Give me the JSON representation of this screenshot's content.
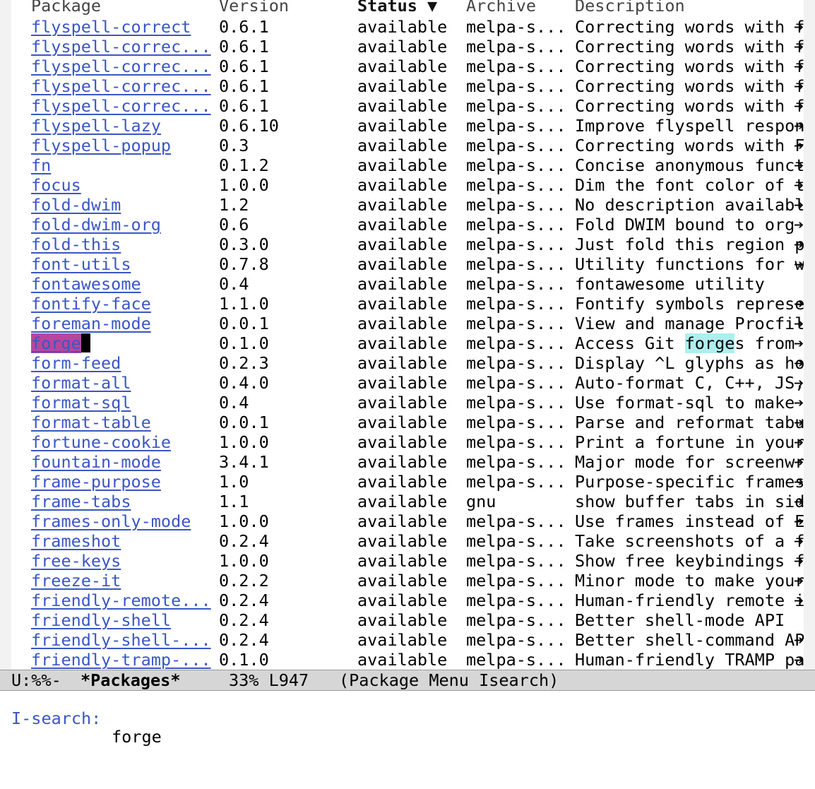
{
  "header": {
    "package": "Package",
    "version": "Version",
    "status": "Status ▼",
    "archive": "Archive",
    "description": "Description"
  },
  "packages": [
    {
      "name": "flyspell-correct",
      "version": "0.6.1",
      "status": "available",
      "archive": "melpa-s...",
      "description": "Correcting words with f",
      "truncated": true
    },
    {
      "name": "flyspell-correc...",
      "version": "0.6.1",
      "status": "available",
      "archive": "melpa-s...",
      "description": "Correcting words with f",
      "truncated": true
    },
    {
      "name": "flyspell-correc...",
      "version": "0.6.1",
      "status": "available",
      "archive": "melpa-s...",
      "description": "Correcting words with f",
      "truncated": true
    },
    {
      "name": "flyspell-correc...",
      "version": "0.6.1",
      "status": "available",
      "archive": "melpa-s...",
      "description": "Correcting words with f",
      "truncated": true
    },
    {
      "name": "flyspell-correc...",
      "version": "0.6.1",
      "status": "available",
      "archive": "melpa-s...",
      "description": "Correcting words with f",
      "truncated": true
    },
    {
      "name": "flyspell-lazy",
      "version": "0.6.10",
      "status": "available",
      "archive": "melpa-s...",
      "description": "Improve flyspell respon",
      "truncated": true
    },
    {
      "name": "flyspell-popup",
      "version": "0.3",
      "status": "available",
      "archive": "melpa-s...",
      "description": "Correcting words with F",
      "truncated": true
    },
    {
      "name": "fn",
      "version": "0.1.2",
      "status": "available",
      "archive": "melpa-s...",
      "description": "Concise anonymous funct",
      "truncated": true
    },
    {
      "name": "focus",
      "version": "1.0.0",
      "status": "available",
      "archive": "melpa-s...",
      "description": "Dim the font color of t",
      "truncated": true
    },
    {
      "name": "fold-dwim",
      "version": "1.2",
      "status": "available",
      "archive": "melpa-s...",
      "description": "No description availabl",
      "truncated": true
    },
    {
      "name": "fold-dwim-org",
      "version": "0.6",
      "status": "available",
      "archive": "melpa-s...",
      "description": "Fold DWIM bound to org ",
      "truncated": true
    },
    {
      "name": "fold-this",
      "version": "0.3.0",
      "status": "available",
      "archive": "melpa-s...",
      "description": "Just fold this region p",
      "truncated": true
    },
    {
      "name": "font-utils",
      "version": "0.7.8",
      "status": "available",
      "archive": "melpa-s...",
      "description": "Utility functions for w",
      "truncated": true
    },
    {
      "name": "fontawesome",
      "version": "0.4",
      "status": "available",
      "archive": "melpa-s...",
      "description": "fontawesome utility",
      "truncated": false
    },
    {
      "name": "fontify-face",
      "version": "1.1.0",
      "status": "available",
      "archive": "melpa-s...",
      "description": "Fontify symbols represe",
      "truncated": true
    },
    {
      "name": "foreman-mode",
      "version": "0.0.1",
      "status": "available",
      "archive": "melpa-s...",
      "description": "View and manage Procfil",
      "truncated": true
    },
    {
      "name": "forge",
      "version": "0.1.0",
      "status": "available",
      "archive": "melpa-s...",
      "description": "Access Git forges from ",
      "truncated": true,
      "current": true
    },
    {
      "name": "form-feed",
      "version": "0.2.3",
      "status": "available",
      "archive": "melpa-s...",
      "description": "Display ^L glyphs as ho",
      "truncated": true
    },
    {
      "name": "format-all",
      "version": "0.4.0",
      "status": "available",
      "archive": "melpa-s...",
      "description": "Auto-format C, C++, JS,",
      "truncated": true
    },
    {
      "name": "format-sql",
      "version": "0.4",
      "status": "available",
      "archive": "melpa-s...",
      "description": "Use format-sql to make ",
      "truncated": true
    },
    {
      "name": "format-table",
      "version": "0.0.1",
      "status": "available",
      "archive": "melpa-s...",
      "description": "Parse and reformat tabu",
      "truncated": true
    },
    {
      "name": "fortune-cookie",
      "version": "1.0.0",
      "status": "available",
      "archive": "melpa-s...",
      "description": "Print a fortune in your",
      "truncated": true
    },
    {
      "name": "fountain-mode",
      "version": "3.4.1",
      "status": "available",
      "archive": "melpa-s...",
      "description": "Major mode for screenwr",
      "truncated": true
    },
    {
      "name": "frame-purpose",
      "version": "1.0",
      "status": "available",
      "archive": "melpa-s...",
      "description": "Purpose-specific frames",
      "truncated": true
    },
    {
      "name": "frame-tabs",
      "version": "1.1",
      "status": "available",
      "archive": "gnu",
      "description": "show buffer tabs in sid",
      "truncated": true
    },
    {
      "name": "frames-only-mode",
      "version": "1.0.0",
      "status": "available",
      "archive": "melpa-s...",
      "description": "Use frames instead of E",
      "truncated": true
    },
    {
      "name": "frameshot",
      "version": "0.2.4",
      "status": "available",
      "archive": "melpa-s...",
      "description": "Take screenshots of a f",
      "truncated": true
    },
    {
      "name": "free-keys",
      "version": "1.0.0",
      "status": "available",
      "archive": "melpa-s...",
      "description": "Show free keybindings f",
      "truncated": true
    },
    {
      "name": "freeze-it",
      "version": "0.2.2",
      "status": "available",
      "archive": "melpa-s...",
      "description": "Minor mode to make your",
      "truncated": true
    },
    {
      "name": "friendly-remote...",
      "version": "0.2.4",
      "status": "available",
      "archive": "melpa-s...",
      "description": "Human-friendly remote i",
      "truncated": true
    },
    {
      "name": "friendly-shell",
      "version": "0.2.4",
      "status": "available",
      "archive": "melpa-s...",
      "description": "Better shell-mode API",
      "truncated": false
    },
    {
      "name": "friendly-shell-...",
      "version": "0.2.4",
      "status": "available",
      "archive": "melpa-s...",
      "description": "Better shell-command AP",
      "truncated": true
    },
    {
      "name": "friendly-tramp-...",
      "version": "0.1.0",
      "status": "available",
      "archive": "melpa-s...",
      "description": "Human-friendly TRAMP pa",
      "truncated": true
    }
  ],
  "search": {
    "query": "forge",
    "prompt": "I-search:"
  },
  "truncation_glyph": "➔",
  "mode_line": {
    "state": "U:%%-",
    "buffer": "*Packages*",
    "position": "33% L947",
    "modes": "(Package Menu Isearch)"
  },
  "colors": {
    "link": "#3a56c4",
    "isearch_match": "#b7479e",
    "lazy_highlight": "#afeeee",
    "mode_line_bg": "#d6d6d6"
  }
}
